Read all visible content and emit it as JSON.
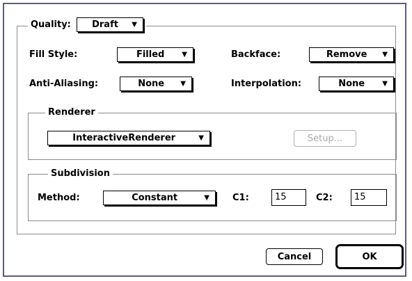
{
  "quality": {
    "label": "Quality:",
    "value": "Draft"
  },
  "fill_style": {
    "label": "Fill Style:",
    "value": "Filled"
  },
  "backface": {
    "label": "Backface:",
    "value": "Remove"
  },
  "anti_aliasing": {
    "label": "Anti-Aliasing:",
    "value": "None"
  },
  "interpolation": {
    "label": "Interpolation:",
    "value": "None"
  },
  "renderer": {
    "title": "Renderer",
    "value": "InteractiveRenderer",
    "setup_label": "Setup..."
  },
  "subdivision": {
    "title": "Subdivision",
    "method_label": "Method:",
    "method_value": "Constant",
    "c1_label": "C1:",
    "c1_value": "15",
    "c2_label": "C2:",
    "c2_value": "15"
  },
  "buttons": {
    "cancel": "Cancel",
    "ok": "OK"
  },
  "icons": {
    "popup_arrow": "triangle-down"
  }
}
